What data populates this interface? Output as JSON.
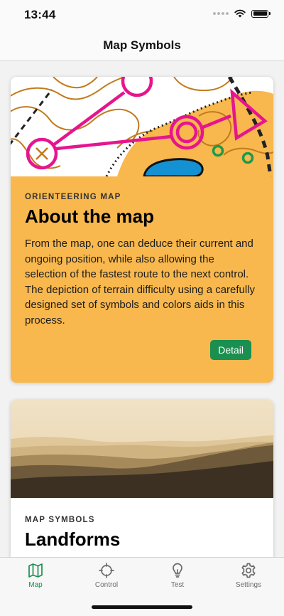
{
  "status_bar": {
    "time": "13:44"
  },
  "nav": {
    "title": "Map Symbols"
  },
  "cards": [
    {
      "overline": "ORIENTEERING MAP",
      "title": "About the map",
      "description": "From the map, one can deduce their current and ongoing position, while also allowing the selection of the fastest route to the next control. The depiction of terrain difficulty using a carefully designed set of symbols and colors aids in this process.",
      "button_label": "Detail"
    },
    {
      "overline": "MAP SYMBOLS",
      "title": "Landforms"
    }
  ],
  "tabs": [
    {
      "label": "Map",
      "icon": "map-icon",
      "active": true
    },
    {
      "label": "Control",
      "icon": "crosshair-icon",
      "active": false
    },
    {
      "label": "Test",
      "icon": "lightbulb-icon",
      "active": false
    },
    {
      "label": "Settings",
      "icon": "gear-icon",
      "active": false
    }
  ],
  "colors": {
    "accent": "#1b8f4f",
    "card_background": "#f8b84e",
    "magenta": "#e6158e"
  }
}
